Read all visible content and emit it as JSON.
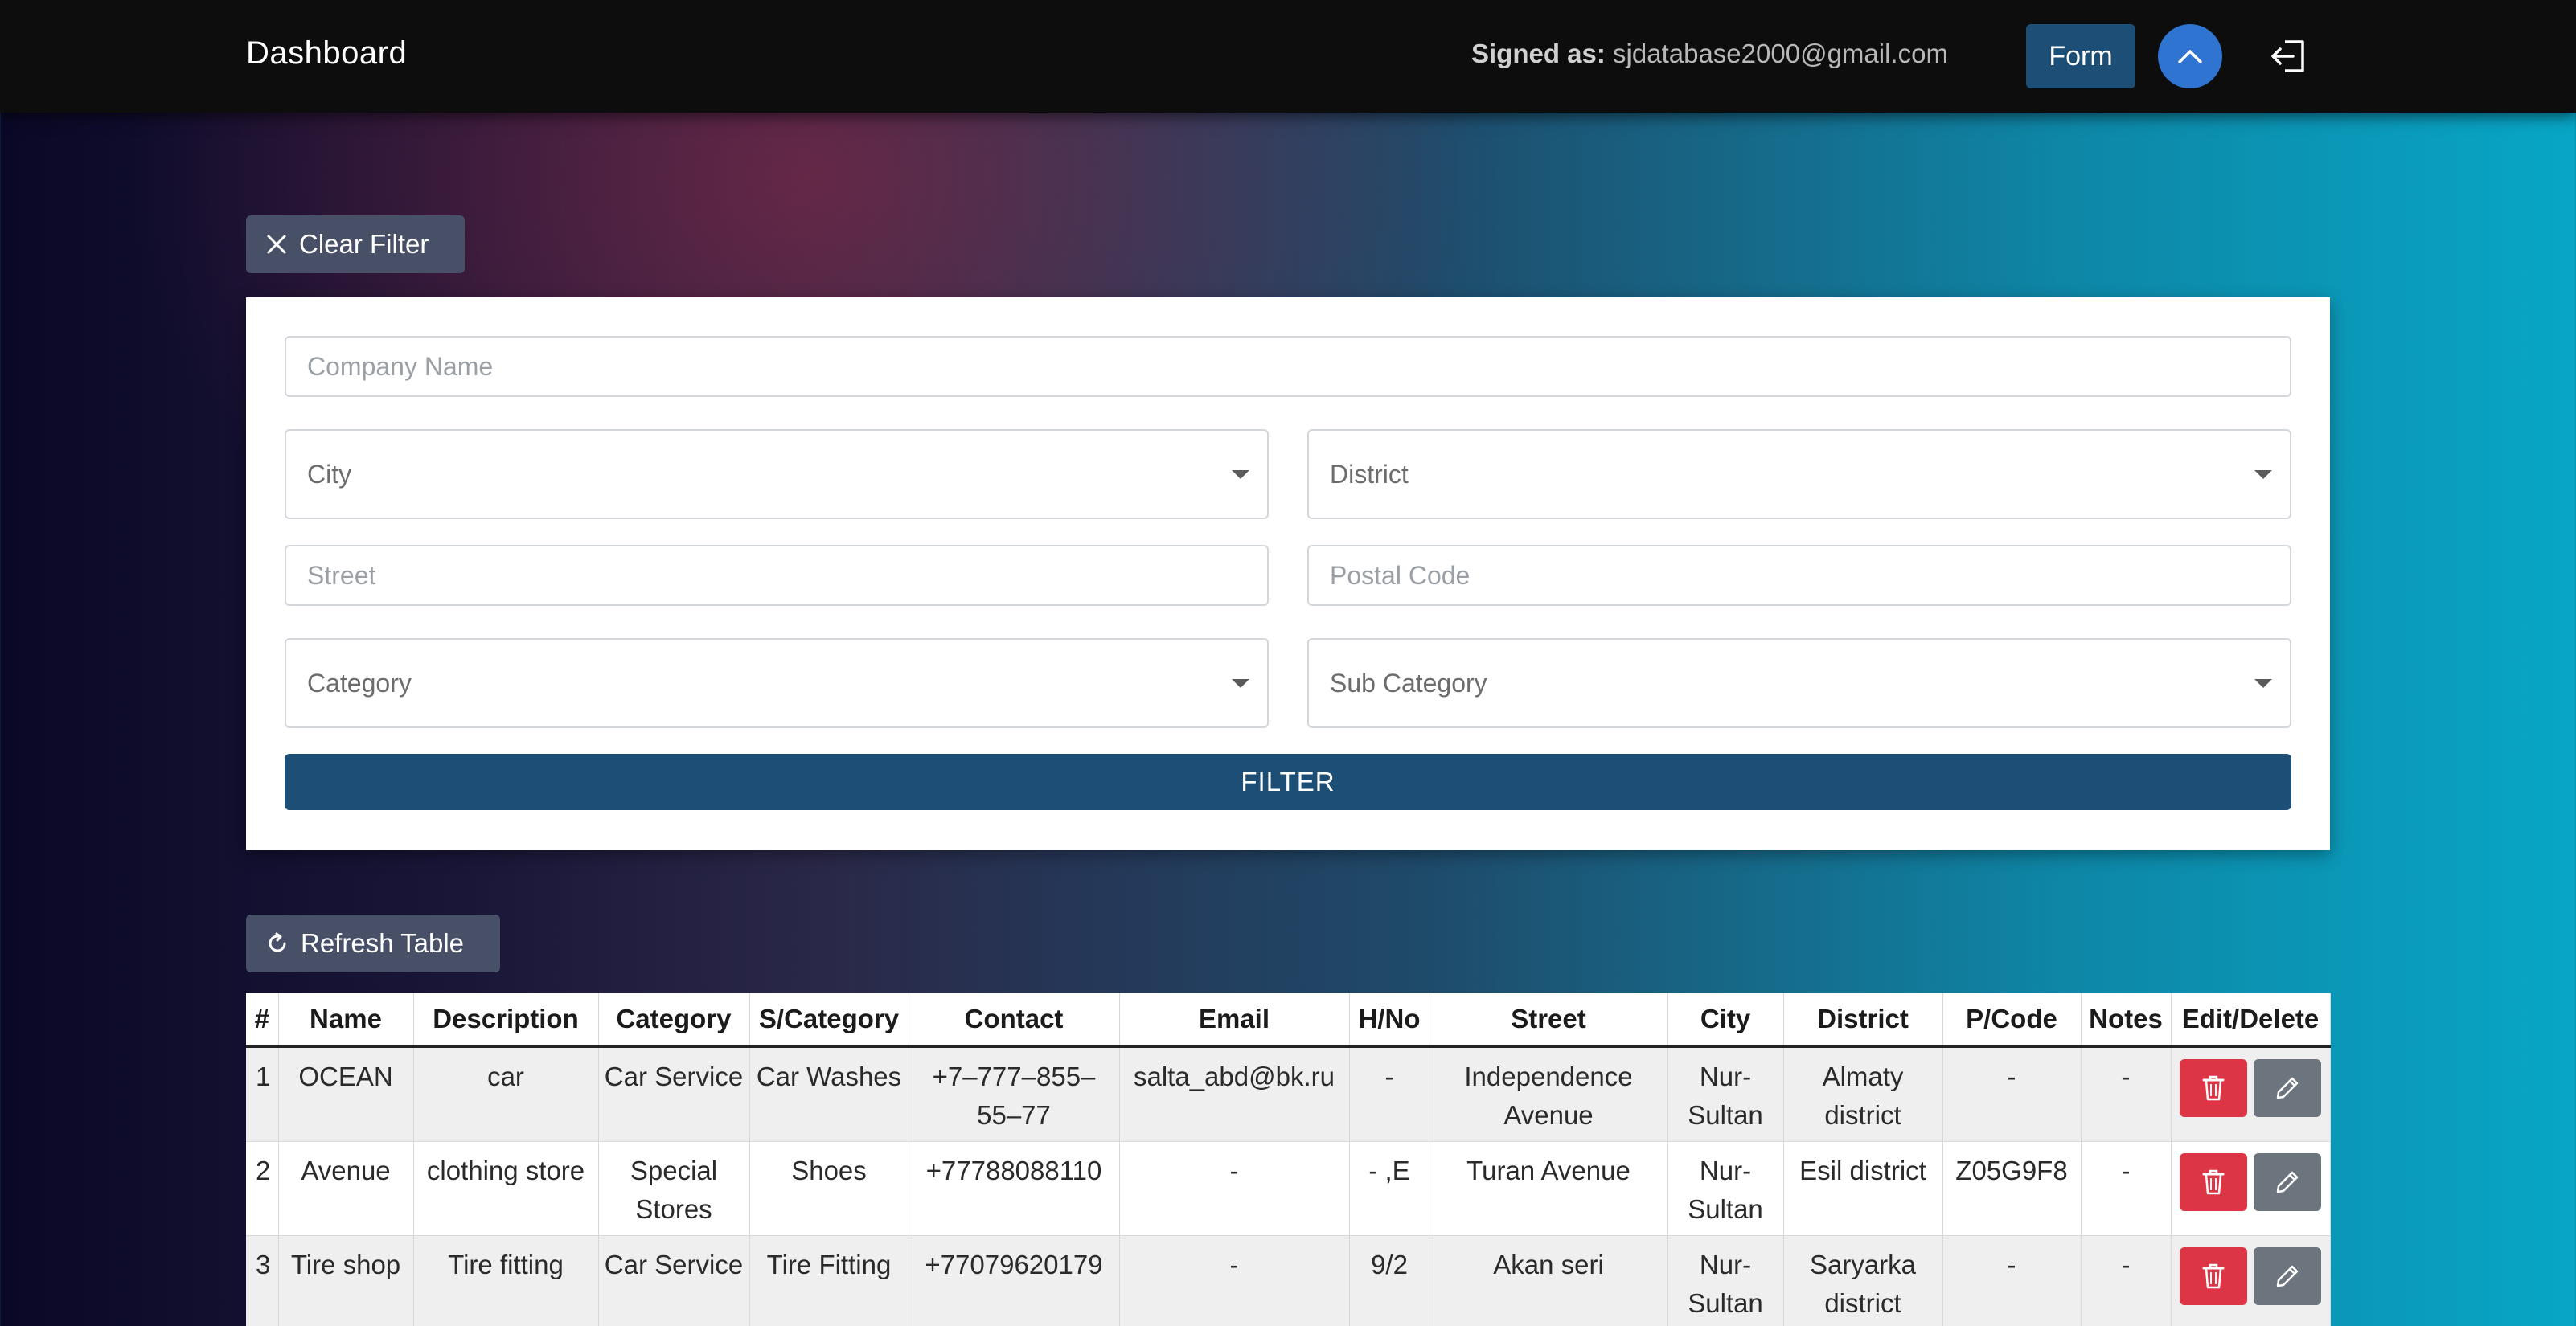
{
  "navbar": {
    "brand": "Dashboard",
    "signed_label": "Signed as:",
    "signed_email": "sjdatabase2000@gmail.com",
    "form_button": "Form",
    "up_icon": "chevron-up-icon",
    "logout_icon": "logout-icon"
  },
  "filters": {
    "clear_button": "Clear Filter",
    "company_placeholder": "Company Name",
    "city_label": "City",
    "district_label": "District",
    "street_placeholder": "Street",
    "postal_placeholder": "Postal Code",
    "category_label": "Category",
    "subcategory_label": "Sub Category",
    "filter_button": "FILTER"
  },
  "table": {
    "refresh_button": "Refresh Table",
    "headers": [
      "#",
      "Name",
      "Description",
      "Category",
      "S/Category",
      "Contact",
      "Email",
      "H/No",
      "Street",
      "City",
      "District",
      "P/Code",
      "Notes",
      "Edit/Delete"
    ],
    "rows": [
      {
        "num": "1",
        "name": "OCEAN",
        "description": "car",
        "category": "Car Service",
        "subcategory": "Car Washes",
        "contact": "+7–777–855–55–77",
        "email": "salta_abd@bk.ru",
        "hno": "-",
        "street": "Independence Avenue",
        "city": "Nur-Sultan",
        "district": "Almaty district",
        "pcode": "-",
        "notes": "-"
      },
      {
        "num": "2",
        "name": "Avenue",
        "description": "clothing store",
        "category": "Special Stores",
        "subcategory": "Shoes",
        "contact": "+77788088110",
        "email": "-",
        "hno": "- ,E",
        "street": "Turan Avenue",
        "city": "Nur-Sultan",
        "district": "Esil district",
        "pcode": "Z05G9F8",
        "notes": "-"
      },
      {
        "num": "3",
        "name": "Tire shop",
        "description": "Tire fitting",
        "category": "Car Service",
        "subcategory": "Tire Fitting",
        "contact": "+77079620179",
        "email": "-",
        "hno": "9/2",
        "street": "Akan seri",
        "city": "Nur-Sultan",
        "district": "Saryarka district",
        "pcode": "-",
        "notes": "-"
      }
    ]
  },
  "colors": {
    "navbar_bg": "#0d0d0d",
    "primary": "#1d4e75",
    "up_button": "#2f74d0",
    "delete": "#dc3545",
    "edit": "#6c757d"
  }
}
